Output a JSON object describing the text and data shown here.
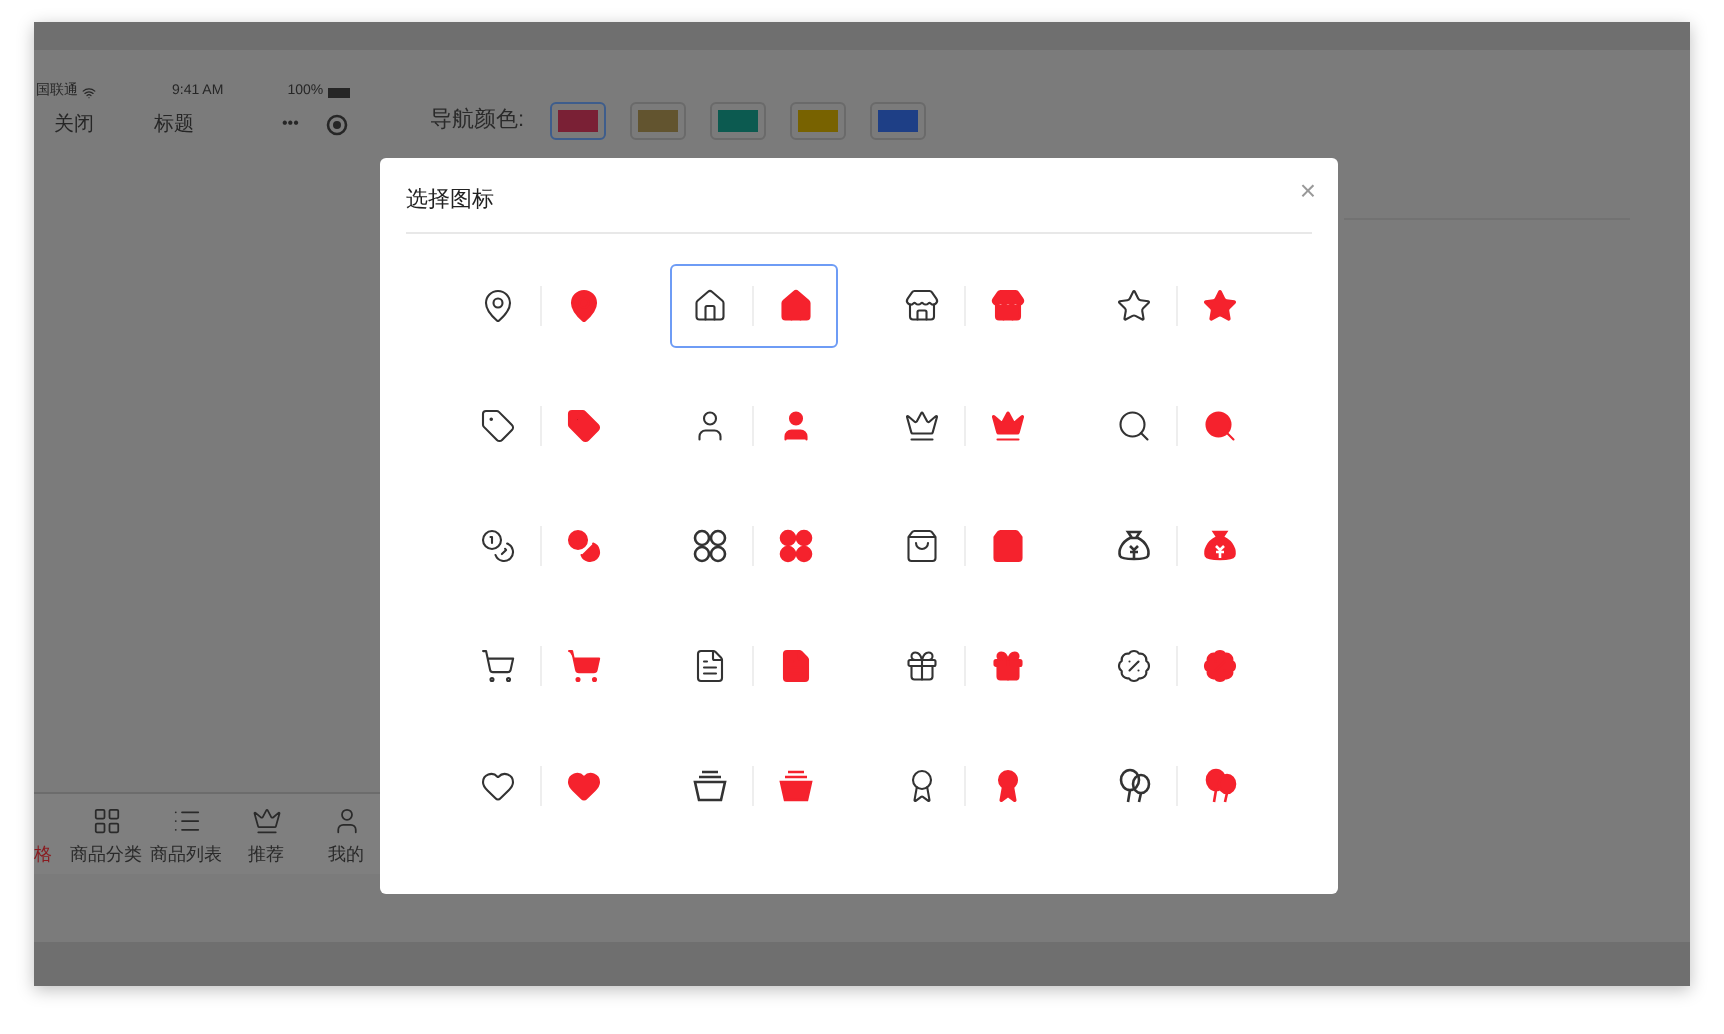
{
  "phone": {
    "status_bar": {
      "carrier": "国联通",
      "time": "9:41 AM",
      "battery": "100%"
    },
    "nav": {
      "back": "关闭",
      "title": "标题",
      "more": "•••"
    },
    "tab_bar": [
      {
        "label": "格",
        "selected": true
      },
      {
        "label": "商品分类",
        "selected": false
      },
      {
        "label": "商品列表",
        "selected": false
      },
      {
        "label": "推荐",
        "selected": false
      },
      {
        "label": "我的",
        "selected": false
      }
    ]
  },
  "nav_color": {
    "label": "导航颜色:",
    "swatches": [
      {
        "color": "#7a2035",
        "selected": true
      },
      {
        "color": "#62542f",
        "selected": false
      },
      {
        "color": "#0c5a50",
        "selected": false
      },
      {
        "color": "#786200",
        "selected": false
      },
      {
        "color": "#1e3f86",
        "selected": false
      }
    ]
  },
  "dialog": {
    "title": "选择图标",
    "close": "×",
    "icons": [
      {
        "selected": false
      },
      {
        "selected": true
      },
      {
        "selected": false
      },
      {
        "selected": false
      },
      {
        "selected": false
      },
      {
        "selected": false
      },
      {
        "selected": false
      },
      {
        "selected": false
      },
      {
        "selected": false
      },
      {
        "selected": false
      },
      {
        "selected": false
      },
      {
        "selected": false
      },
      {
        "selected": false
      },
      {
        "selected": false
      },
      {
        "selected": false
      },
      {
        "selected": false
      },
      {
        "selected": false
      },
      {
        "selected": false
      },
      {
        "selected": false
      },
      {
        "selected": false
      }
    ]
  }
}
